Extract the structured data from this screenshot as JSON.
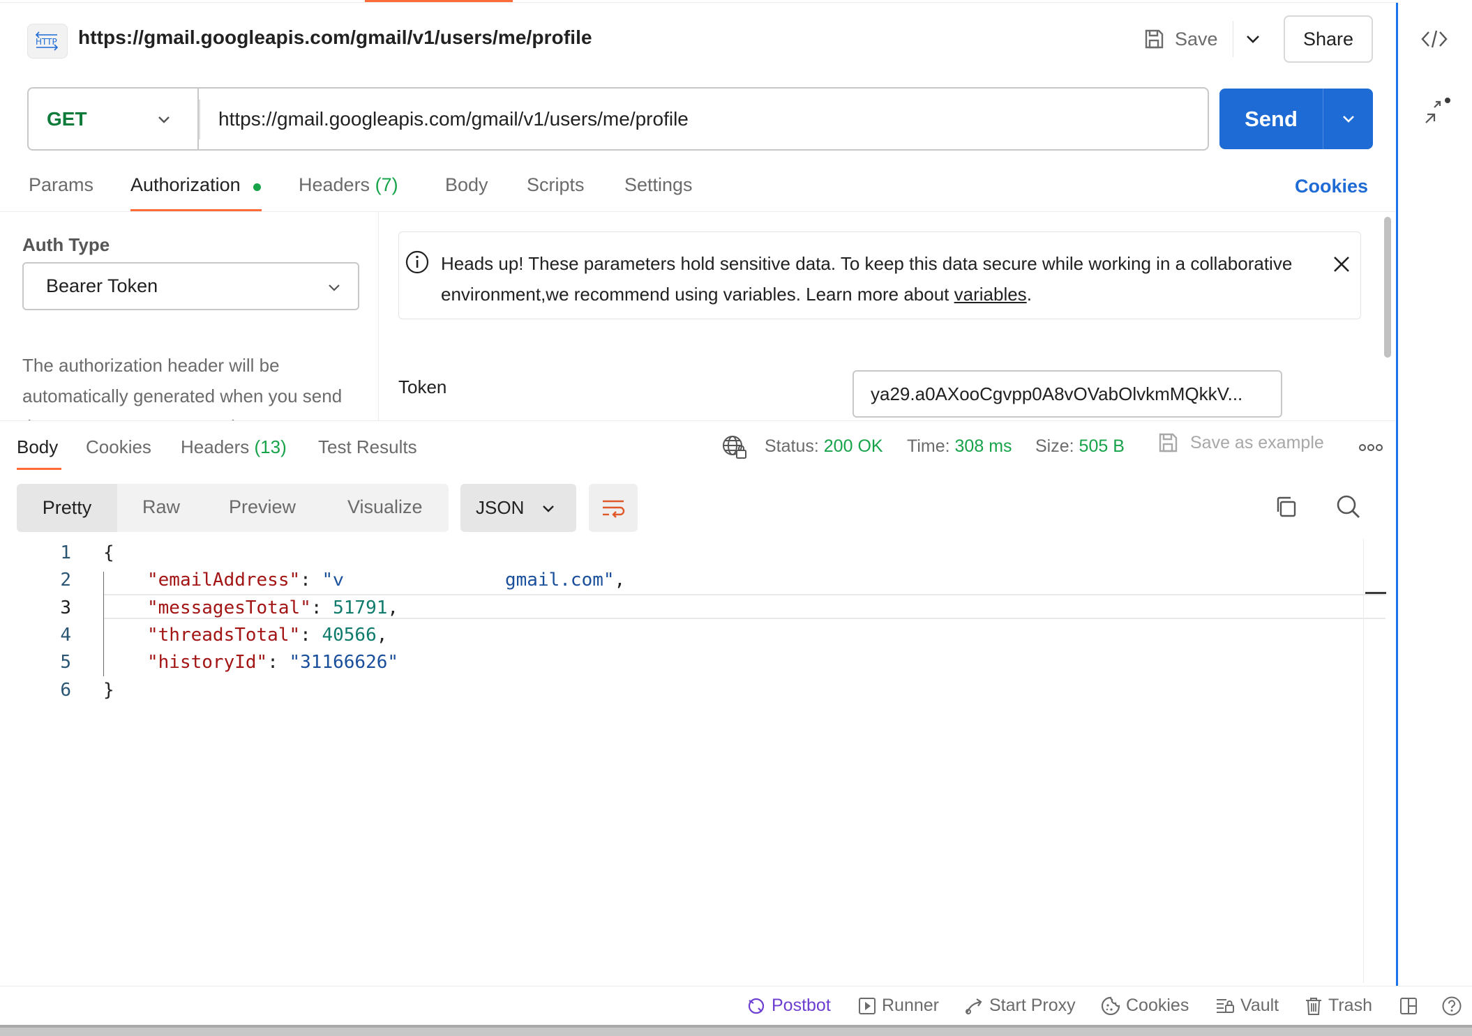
{
  "request": {
    "title": "https://gmail.googleapis.com/gmail/v1/users/me/profile",
    "badge": "HTTP",
    "save_label": "Save",
    "share_label": "Share",
    "method": "GET",
    "url": "https://gmail.googleapis.com/gmail/v1/users/me/profile",
    "send_label": "Send"
  },
  "request_tabs": {
    "params": "Params",
    "authorization": "Authorization",
    "headers": "Headers",
    "headers_count": "(7)",
    "body": "Body",
    "scripts": "Scripts",
    "settings": "Settings",
    "cookies": "Cookies"
  },
  "auth": {
    "type_label": "Auth Type",
    "type_value": "Bearer Token",
    "description": "The authorization header will be automatically generated when you send the request. Learn more about",
    "alert_text": "Heads up! These parameters hold sensitive data. To keep this data secure while working in a collaborative environment,we recommend using variables. Learn more about",
    "alert_link": "variables",
    "alert_end": ".",
    "token_label": "Token",
    "token_value": "ya29.a0AXooCgvpp0A8vOVabOlvkmMQkkV..."
  },
  "response_tabs": {
    "body": "Body",
    "cookies": "Cookies",
    "headers": "Headers",
    "headers_count": "(13)",
    "tests": "Test Results"
  },
  "response_stats": {
    "status_label": "Status:",
    "status_value": "200 OK",
    "time_label": "Time:",
    "time_value": "308 ms",
    "size_label": "Size:",
    "size_value": "505 B",
    "save_example": "Save as example"
  },
  "view": {
    "pretty": "Pretty",
    "raw": "Raw",
    "preview": "Preview",
    "visualize": "Visualize",
    "format": "JSON"
  },
  "code": {
    "line_numbers": [
      "1",
      "2",
      "3",
      "4",
      "5",
      "6"
    ],
    "open_brace": "{",
    "close_brace": "}",
    "email_key": "\"emailAddress\"",
    "email_value_start": "\"ᴠ",
    "email_value_end": "gmail.com\"",
    "messages_key": "\"messagesTotal\"",
    "messages_value": "51791",
    "threads_key": "\"threadsTotal\"",
    "threads_value": "40566",
    "history_key": "\"historyId\"",
    "history_value": "\"31166626\""
  },
  "footer": {
    "postbot": "Postbot",
    "runner": "Runner",
    "proxy": "Start Proxy",
    "cookies": "Cookies",
    "vault": "Vault",
    "trash": "Trash"
  },
  "colors": {
    "accent": "#ff6c37",
    "send": "#1f6bd6",
    "success": "#16a34a",
    "method_get": "#0f7b3a",
    "json_key": "#a31515",
    "json_number": "#0f7b6c",
    "json_string": "#1a4f9c"
  }
}
